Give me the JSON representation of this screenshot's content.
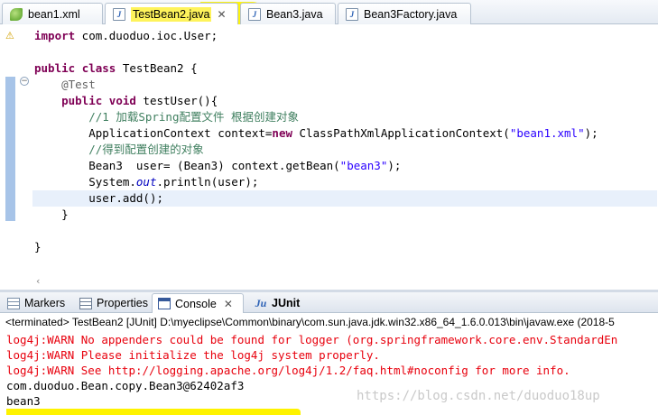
{
  "editor_tabs": [
    {
      "label": "bean1.xml",
      "icon": "xml-file-icon"
    },
    {
      "label": "TestBean2.java",
      "icon": "java-file-icon",
      "active": true
    },
    {
      "label": "Bean3.java",
      "icon": "java-file-icon"
    },
    {
      "label": "Bean3Factory.java",
      "icon": "java-file-icon"
    }
  ],
  "code": {
    "l1_kw": "import",
    "l1_rest": " com.duoduo.ioc.User;",
    "l3_kw1": "public",
    "l3_kw2": "class",
    "l3_rest": " TestBean2 {",
    "l4_ann": "@Test",
    "l5_kw1": "public",
    "l5_kw2": "void",
    "l5_rest": " testUser(){",
    "l6_comment": "//1 加载Spring配置文件 根据创建对象",
    "l7_a": "ApplicationContext context=",
    "l7_kw": "new",
    "l7_b": " ClassPathXmlApplicationContext(",
    "l7_str": "\"bean1.xml\"",
    "l7_c": ");",
    "l8_comment": "//得到配置创建的对象",
    "l9_a": "Bean3  user= (Bean3) context.getBean(",
    "l9_str": "\"bean3\"",
    "l9_c": ");",
    "l10_a": "System.",
    "l10_fld": "out",
    "l10_b": ".println(user);",
    "l11": "user.add();",
    "l12": "}",
    "l14": "}"
  },
  "view_tabs": {
    "markers": "Markers",
    "properties": "Properties",
    "console": "Console",
    "junit": "JUnit"
  },
  "console": {
    "terminated": "<terminated> TestBean2 [JUnit] D:\\myeclipse\\Common\\binary\\com.sun.java.jdk.win32.x86_64_1.6.0.013\\bin\\javaw.exe (2018-5",
    "lines": [
      "log4j:WARN No appenders could be found for logger (org.springframework.core.env.StandardEn",
      "log4j:WARN Please initialize the log4j system properly.",
      "log4j:WARN See http://logging.apache.org/log4j/1.2/faq.html#noconfig for more info.",
      "com.duoduo.Bean.copy.Bean3@62402af3",
      "bean3"
    ],
    "error_color": "#e8000d"
  },
  "watermark": "https://blog.csdn.net/duoduo18up",
  "colors": {
    "keyword": "#7f0055",
    "comment": "#3f7f5f",
    "string": "#2a00ff",
    "highlight": "#fef300"
  }
}
